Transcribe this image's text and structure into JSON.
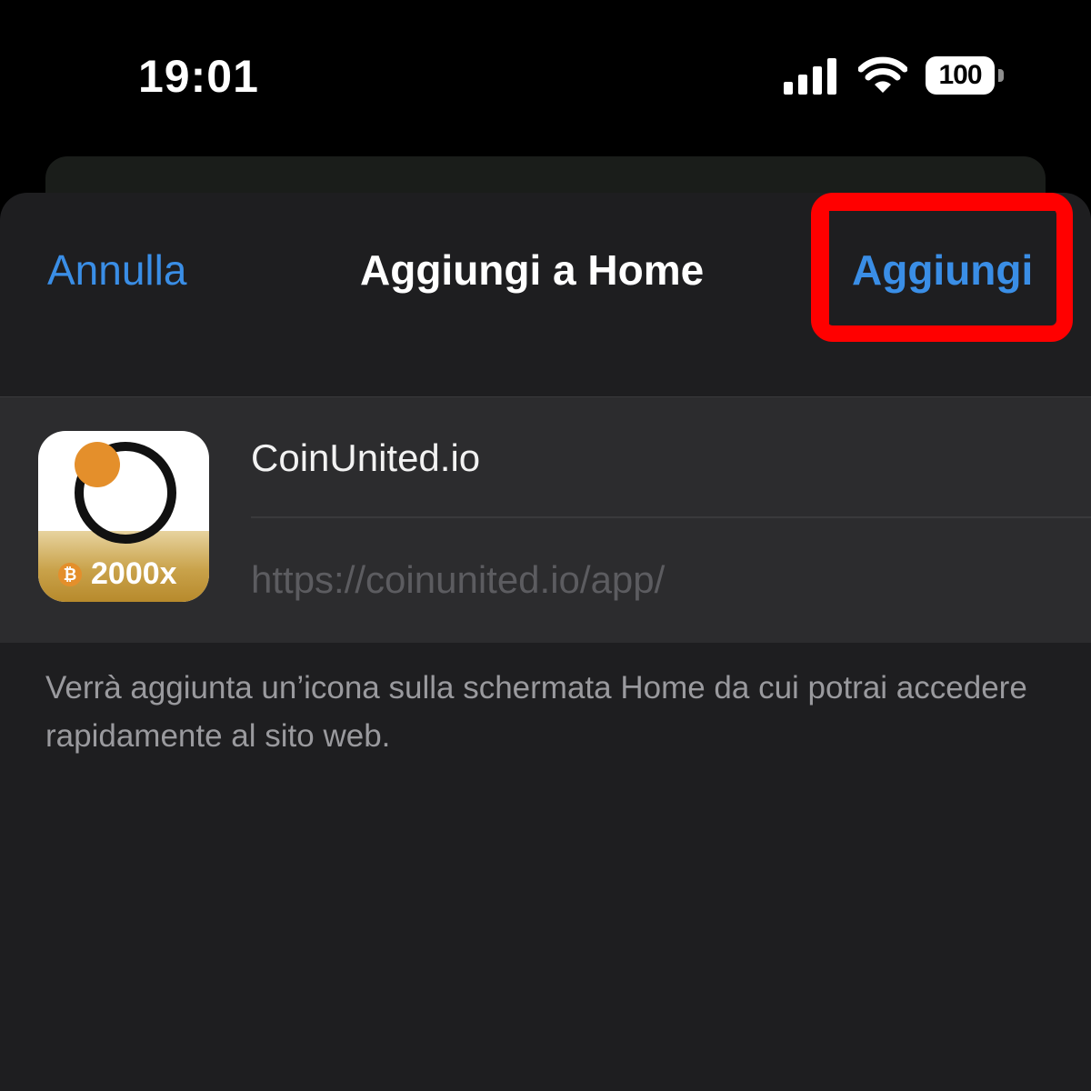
{
  "status_bar": {
    "time": "19:01",
    "battery_level": "100",
    "icons": [
      "signal-icon",
      "wifi-icon",
      "battery-icon"
    ]
  },
  "nav": {
    "cancel_label": "Annulla",
    "title": "Aggiungi a Home",
    "add_label": "Aggiungi"
  },
  "shortcut": {
    "icon_badge": "2000x",
    "icon_coin_symbol": "₿",
    "name": "CoinUnited.io",
    "url": "https://coinunited.io/app/"
  },
  "description": "Verrà aggiunta un’icona sulla schermata Home da cui potrai accedere rapidamente al sito web.",
  "colors": {
    "accent": "#3a8ee6",
    "highlight": "#ff0000",
    "sheet_background": "#1e1e20",
    "group_background": "#2c2c2e",
    "icon_orange": "#e48f2b",
    "icon_gold": "#c9a24a"
  }
}
